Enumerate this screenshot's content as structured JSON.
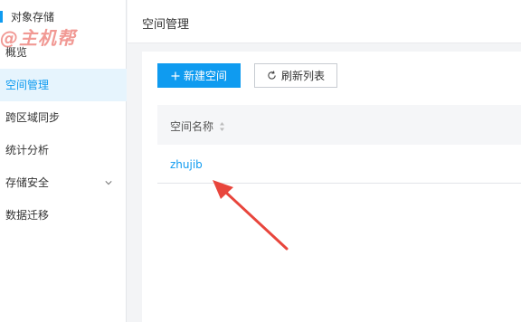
{
  "sidebar": {
    "title": "对象存储",
    "watermark": "@主机帮",
    "items": [
      {
        "label": "概览"
      },
      {
        "label": "空间管理"
      },
      {
        "label": "跨区域同步"
      },
      {
        "label": "统计分析"
      },
      {
        "label": "存储安全"
      },
      {
        "label": "数据迁移"
      }
    ]
  },
  "header": {
    "title": "空间管理"
  },
  "toolbar": {
    "create_label": "新建空间",
    "refresh_label": "刷新列表"
  },
  "table": {
    "columns": [
      "空间名称"
    ],
    "rows": [
      {
        "name": "zhujib"
      }
    ]
  },
  "colors": {
    "accent": "#0f9bf0",
    "arrow": "#e8453c"
  }
}
